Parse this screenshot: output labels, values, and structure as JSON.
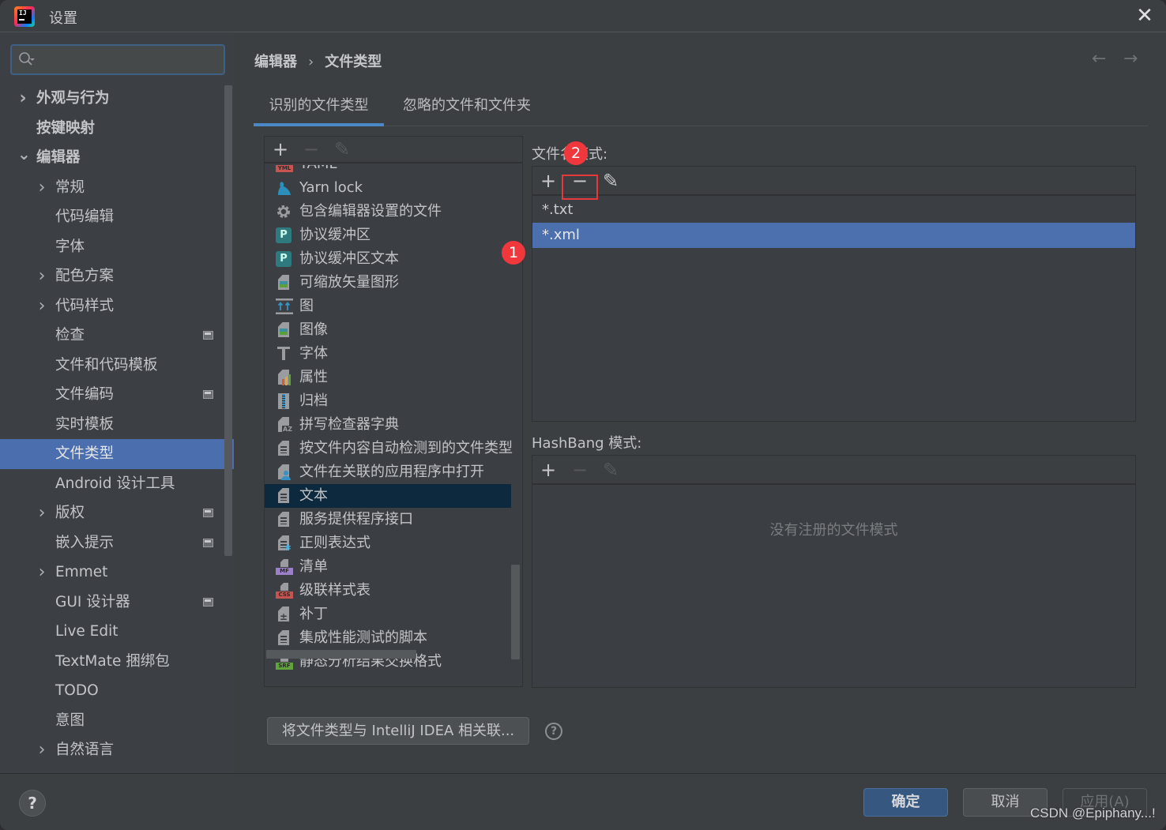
{
  "window": {
    "title": "设置",
    "close_icon": "close-icon"
  },
  "search": {
    "value": "",
    "placeholder": ""
  },
  "sidebar": {
    "items": [
      {
        "label": "外观与行为",
        "level": 0,
        "bold": true,
        "chevron": "right",
        "project_icon": false
      },
      {
        "label": "按键映射",
        "level": 0,
        "bold": true,
        "chevron": "",
        "project_icon": false
      },
      {
        "label": "编辑器",
        "level": 0,
        "bold": true,
        "chevron": "down",
        "project_icon": false
      },
      {
        "label": "常规",
        "level": 1,
        "bold": false,
        "chevron": "right",
        "project_icon": false
      },
      {
        "label": "代码编辑",
        "level": 1,
        "bold": false,
        "chevron": "",
        "project_icon": false
      },
      {
        "label": "字体",
        "level": 1,
        "bold": false,
        "chevron": "",
        "project_icon": false
      },
      {
        "label": "配色方案",
        "level": 1,
        "bold": false,
        "chevron": "right",
        "project_icon": false
      },
      {
        "label": "代码样式",
        "level": 1,
        "bold": false,
        "chevron": "right",
        "project_icon": false
      },
      {
        "label": "检查",
        "level": 1,
        "bold": false,
        "chevron": "",
        "project_icon": true
      },
      {
        "label": "文件和代码模板",
        "level": 1,
        "bold": false,
        "chevron": "",
        "project_icon": false
      },
      {
        "label": "文件编码",
        "level": 1,
        "bold": false,
        "chevron": "",
        "project_icon": true
      },
      {
        "label": "实时模板",
        "level": 1,
        "bold": false,
        "chevron": "",
        "project_icon": false
      },
      {
        "label": "文件类型",
        "level": 1,
        "bold": false,
        "chevron": "",
        "project_icon": false,
        "selected": true
      },
      {
        "label": "Android 设计工具",
        "level": 1,
        "bold": false,
        "chevron": "",
        "project_icon": false
      },
      {
        "label": "版权",
        "level": 1,
        "bold": false,
        "chevron": "right",
        "project_icon": true
      },
      {
        "label": "嵌入提示",
        "level": 1,
        "bold": false,
        "chevron": "",
        "project_icon": true
      },
      {
        "label": "Emmet",
        "level": 1,
        "bold": false,
        "chevron": "right",
        "project_icon": false
      },
      {
        "label": "GUI 设计器",
        "level": 1,
        "bold": false,
        "chevron": "",
        "project_icon": true
      },
      {
        "label": "Live Edit",
        "level": 1,
        "bold": false,
        "chevron": "",
        "project_icon": false
      },
      {
        "label": "TextMate 捆绑包",
        "level": 1,
        "bold": false,
        "chevron": "",
        "project_icon": false
      },
      {
        "label": "TODO",
        "level": 1,
        "bold": false,
        "chevron": "",
        "project_icon": false
      },
      {
        "label": "意图",
        "level": 1,
        "bold": false,
        "chevron": "",
        "project_icon": false
      },
      {
        "label": "自然语言",
        "level": 1,
        "bold": false,
        "chevron": "right",
        "project_icon": false
      }
    ]
  },
  "breadcrumb": {
    "parent": "编辑器",
    "separator": "›",
    "current": "文件类型"
  },
  "nav": {
    "back": "←",
    "forward": "→"
  },
  "tabs": [
    {
      "label": "识别的文件类型",
      "active": true
    },
    {
      "label": "忽略的文件和文件夹",
      "active": false
    }
  ],
  "toolbar_icons": {
    "add": "+",
    "remove": "−",
    "edit": "✎"
  },
  "file_types": [
    {
      "label": "YAML",
      "icon": "yml-icon",
      "badge": "YML",
      "badge_color": "#c75450"
    },
    {
      "label": "Yarn lock",
      "icon": "yarn-icon"
    },
    {
      "label": "包含编辑器设置的文件",
      "icon": "gear-icon"
    },
    {
      "label": "协议缓冲区",
      "icon": "protobuf-icon"
    },
    {
      "label": "协议缓冲区文本",
      "icon": "protobuf-icon"
    },
    {
      "label": "可缩放矢量图形",
      "icon": "image-file-icon"
    },
    {
      "label": "图",
      "icon": "diagram-icon"
    },
    {
      "label": "图像",
      "icon": "image-file-icon"
    },
    {
      "label": "字体",
      "icon": "font-icon"
    },
    {
      "label": "属性",
      "icon": "properties-icon"
    },
    {
      "label": "归档",
      "icon": "archive-icon"
    },
    {
      "label": "拼写检查器字典",
      "icon": "dictionary-icon"
    },
    {
      "label": "按文件内容自动检测到的文件类型",
      "icon": "text-file-icon"
    },
    {
      "label": "文件在关联的应用程序中打开",
      "icon": "native-file-icon"
    },
    {
      "label": "文本",
      "icon": "text-file-icon",
      "selected": true
    },
    {
      "label": "服务提供程序接口",
      "icon": "text-file-icon"
    },
    {
      "label": "正则表达式",
      "icon": "regexp-icon"
    },
    {
      "label": "清单",
      "icon": "manifest-icon",
      "badge": "MF",
      "badge_color": "#9b7fc7"
    },
    {
      "label": "级联样式表",
      "icon": "css-icon",
      "badge": "CSS",
      "badge_color": "#c75450"
    },
    {
      "label": "补丁",
      "icon": "patch-icon"
    },
    {
      "label": "集成性能测试的脚本",
      "icon": "text-file-icon"
    },
    {
      "label": "静态分析结果交换格式",
      "icon": "sarif-icon",
      "badge": "SRF",
      "badge_color": "#5fa33a"
    }
  ],
  "file_name_patterns": {
    "label": "文件名模式:",
    "items": [
      {
        "value": "*.txt",
        "selected": false
      },
      {
        "value": "*.xml",
        "selected": true
      }
    ]
  },
  "hashbang_patterns": {
    "label": "HashBang 模式:",
    "empty_text": "没有注册的文件模式"
  },
  "annotations": {
    "marker_1": "1",
    "marker_2": "2",
    "color": "#f0383c"
  },
  "associate_button": "将文件类型与 IntelliJ IDEA 相关联...",
  "help_glyph": "?",
  "footer": {
    "ok": "确定",
    "cancel": "取消",
    "apply": "应用(A)",
    "watermark": "CSDN @Epiphany...!"
  },
  "colors": {
    "accent": "#4a88c7",
    "selection": "#4b6eaf",
    "ok_button": "#365880"
  }
}
